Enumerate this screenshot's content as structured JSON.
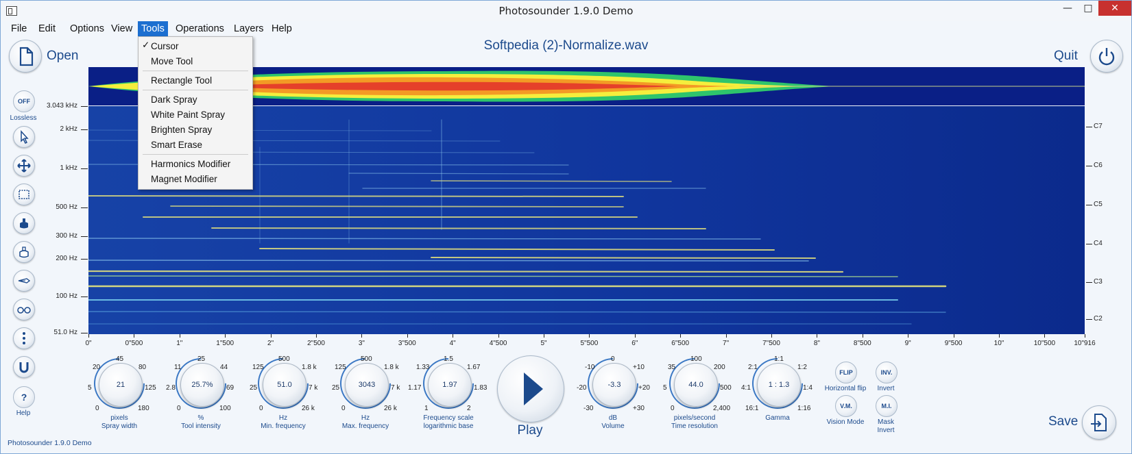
{
  "app": {
    "title": "Photosounder 1.9.0 Demo",
    "status_text": "Photosounder 1.9.0 Demo"
  },
  "window_controls": {
    "minimize": "—",
    "maximize": "□",
    "close": "✕"
  },
  "menu": [
    "File",
    "Edit",
    "Options",
    "View",
    "Tools",
    "Operations",
    "Layers",
    "Help"
  ],
  "tools_menu": {
    "checked": "✓",
    "items": [
      "Cursor",
      "Move Tool",
      "Rectangle Tool",
      "Dark Spray",
      "White Paint Spray",
      "Brighten Spray",
      "Smart Erase",
      "Harmonics Modifier",
      "Magnet Modifier"
    ]
  },
  "header": {
    "open_label": "Open",
    "quit_label": "Quit",
    "save_label": "Save",
    "filename": "Softpedia (2)-Normalize.wav"
  },
  "left_tools": {
    "lossless_button": "OFF",
    "lossless_label": "Lossless",
    "help_button": "?",
    "help_label": "Help"
  },
  "freq_axis": [
    "3.043 kHz",
    "2 kHz",
    "1 kHz",
    "500 Hz",
    "300 Hz",
    "200 Hz",
    "100 Hz",
    "51.0 Hz"
  ],
  "note_axis": [
    "C7",
    "C6",
    "C5",
    "C4",
    "C3",
    "C2"
  ],
  "time_axis": [
    "0\"",
    "0\"500",
    "1\"",
    "1\"500",
    "2\"",
    "2\"500",
    "3\"",
    "3\"500",
    "4\"",
    "4\"500",
    "5\"",
    "5\"500",
    "6\"",
    "6\"500",
    "7\"",
    "7\"500",
    "8\"",
    "8\"500",
    "9\"",
    "9\"500",
    "10\"",
    "10\"500",
    "10\"916"
  ],
  "knobs": [
    {
      "value": "21",
      "unit": "pixels",
      "label": "Spray width",
      "ticks": [
        "20",
        "45",
        "80",
        "5",
        "125",
        "0",
        "180"
      ]
    },
    {
      "value": "25.7%",
      "unit": "%",
      "label": "Tool intensity",
      "ticks": [
        "11",
        "25",
        "44",
        "2.8",
        "69",
        "0",
        "100"
      ]
    },
    {
      "value": "51.0",
      "unit": "Hz",
      "label": "Min. frequency",
      "ticks": [
        "125",
        "500",
        "1.8 k",
        "25",
        "7 k",
        "0",
        "26 k"
      ]
    },
    {
      "value": "3043",
      "unit": "Hz",
      "label": "Max. frequency",
      "ticks": [
        "125",
        "500",
        "1.8 k",
        "25",
        "7 k",
        "0",
        "26 k"
      ]
    },
    {
      "value": "1.97",
      "unit": "Frequency scale",
      "label": "logarithmic base",
      "ticks": [
        "1.33",
        "1.5",
        "1.67",
        "1.17",
        "1.83",
        "1",
        "2"
      ]
    },
    {
      "value": "-3.3",
      "unit": "dB",
      "label": "Volume",
      "ticks": [
        "-10",
        "0",
        "+10",
        "-20",
        "+20",
        "-30",
        "+30"
      ]
    },
    {
      "value": "44.0",
      "unit": "pixels/second",
      "label": "Time resolution",
      "ticks": [
        "35",
        "100",
        "200",
        "5",
        "500",
        "0",
        "2,400"
      ]
    },
    {
      "value": "1 : 1.3",
      "unit": "Gamma",
      "label": "",
      "ticks": [
        "2:1",
        "1:1",
        "1:2",
        "4:1",
        "1:4",
        "16:1",
        "1:16"
      ]
    }
  ],
  "play": {
    "label": "Play"
  },
  "toggles": [
    {
      "button": "FLIP",
      "label": "Horizontal flip"
    },
    {
      "button": "INV.",
      "label": "Invert"
    },
    {
      "button": "V.M.",
      "label": "Vision Mode"
    },
    {
      "button": "M.I.",
      "label": "Mask Invert"
    }
  ]
}
